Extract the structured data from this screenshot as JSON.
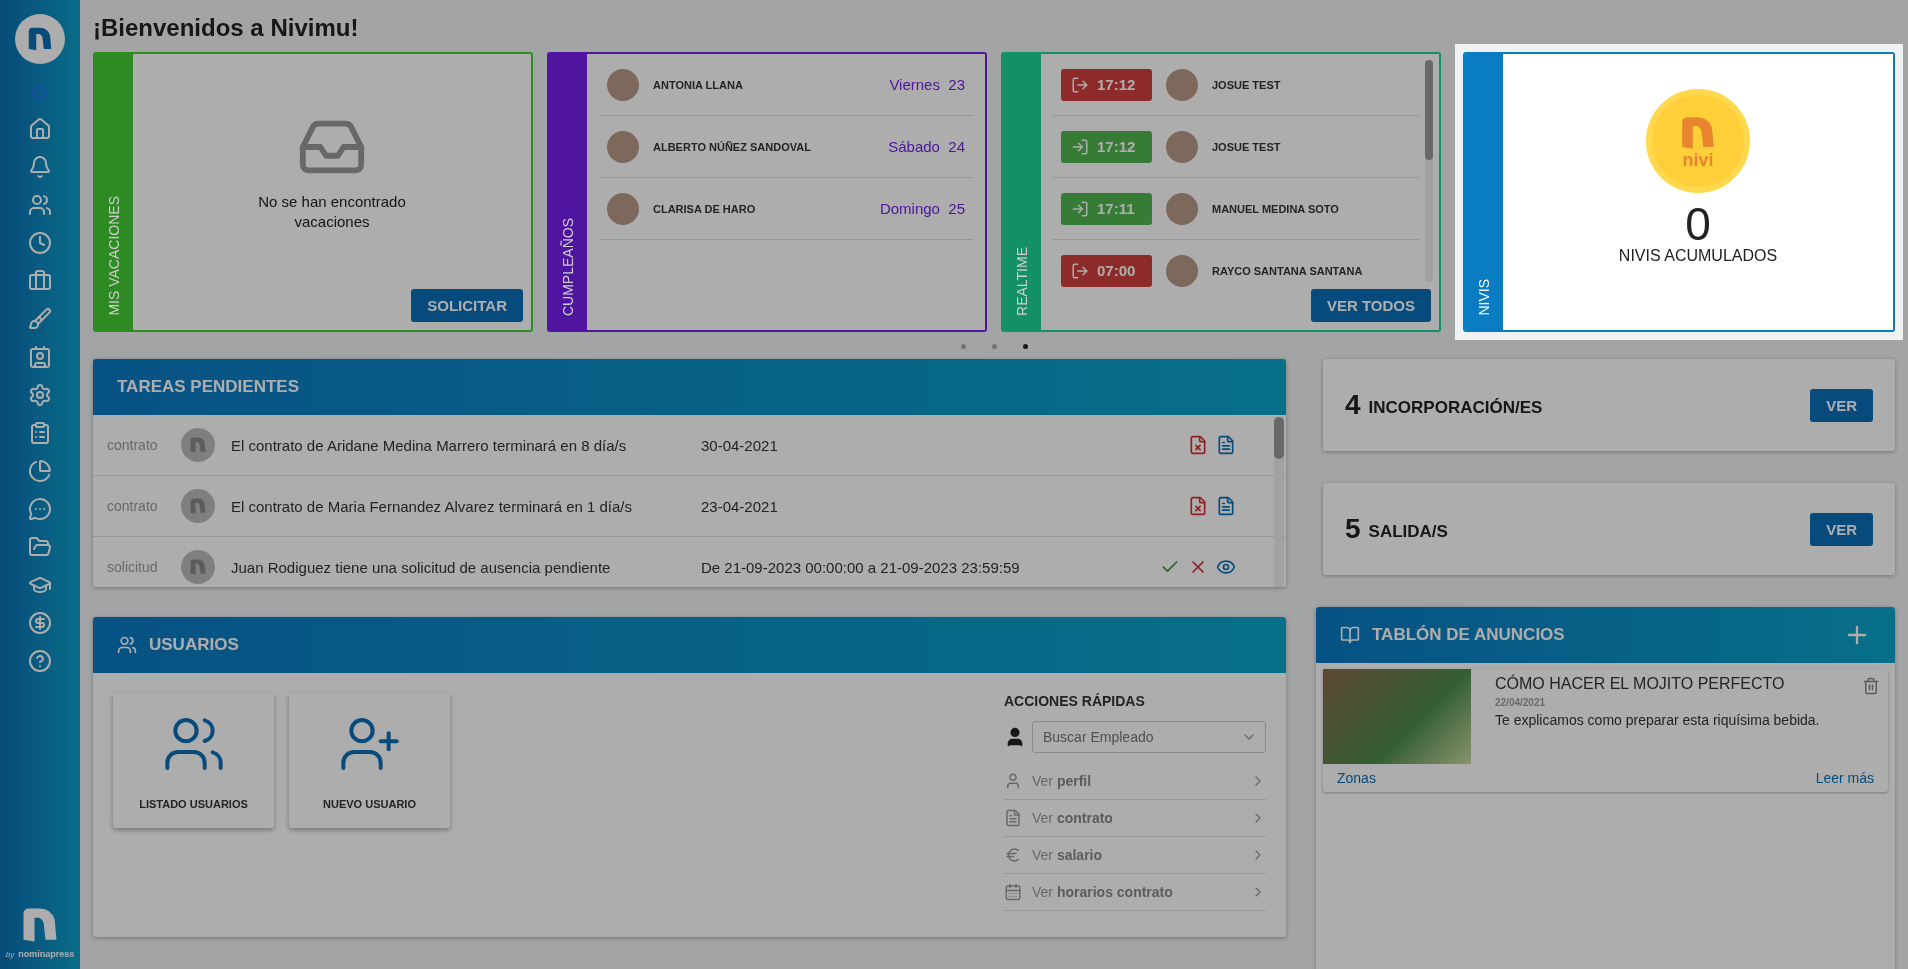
{
  "sidebar": {
    "brand_by": "by",
    "brand_name": "nominapress"
  },
  "title": "¡Bienvenidos a Nivimu!",
  "top_cards": [
    {
      "kind": "vacations",
      "title": "MIS VACACIONES",
      "color": "#2e8a22",
      "highlighted": false,
      "empty_text": "No se han encontrado vacaciones",
      "button": "SOLICITAR"
    },
    {
      "kind": "birthdays",
      "title": "CUMPLEAÑOS",
      "color": "#4f14a0",
      "highlighted": false,
      "people": [
        {
          "name": "ANTONIA LLANA",
          "day": "Viernes",
          "date": "23"
        },
        {
          "name": "ALBERTO NÚÑEZ SANDOVAL",
          "day": "Sábado",
          "date": "24"
        },
        {
          "name": "CLARISA DE HARO",
          "day": "Domingo",
          "date": "25"
        }
      ]
    },
    {
      "kind": "realtime",
      "title": "REALTIME",
      "color": "#139068",
      "highlighted": false,
      "button": "VER TODOS",
      "entries": [
        {
          "kind": "exit",
          "time": "17:12",
          "name": "JOSUE TEST"
        },
        {
          "kind": "entry",
          "time": "17:12",
          "name": "JOSUE TEST"
        },
        {
          "kind": "entry",
          "time": "17:11",
          "name": "MANUEL MEDINA SOTO"
        },
        {
          "kind": "exit",
          "time": "07:00",
          "name": "RAYCO SANTANA SANTANA"
        }
      ]
    },
    {
      "kind": "nivis",
      "title": "NIVIS",
      "color": "#0a7cc1",
      "highlighted": true,
      "coin_label": "nivi",
      "count": "0",
      "caption": "NIVIS ACUMULADOS"
    }
  ],
  "carousel_dots": [
    {
      "selected": false
    },
    {
      "selected": false
    },
    {
      "selected": true
    }
  ],
  "tasks": {
    "title": "TAREAS PENDIENTES",
    "rows": [
      {
        "kind": "contract",
        "type": "contrato",
        "text": "El contrato de Aridane Medina Marrero terminará en 8 día/s",
        "date": "30-04-2021"
      },
      {
        "kind": "contract",
        "type": "contrato",
        "text": "El contrato de Maria Fernandez Alvarez terminará en 1 día/s",
        "date": "23-04-2021"
      },
      {
        "kind": "request",
        "type": "solicitud",
        "text": "Juan Rodiguez tiene una solicitud de ausencia pendiente",
        "date": "De 21-09-2023 00:00:00 a 21-09-2023 23:59:59"
      }
    ]
  },
  "counters": [
    {
      "number": "4",
      "label": "INCORPORACIÓN/ES",
      "button": "VER"
    },
    {
      "number": "5",
      "label": "SALIDA/S",
      "button": "VER"
    }
  ],
  "users": {
    "title": "USUARIOS",
    "tiles": [
      {
        "kind": "list",
        "label": "LISTADO USUARIOS"
      },
      {
        "kind": "new",
        "label": "NUEVO USUARIO"
      }
    ],
    "quick_title": "ACCIONES RÁPIDAS",
    "search": {
      "placeholder": "Buscar Empleado"
    },
    "actions": [
      {
        "kind": "profile",
        "label": "Ver **perfil**"
      },
      {
        "kind": "contract",
        "label": "Ver **contrato**"
      },
      {
        "kind": "salary",
        "label": "Ver **salario**"
      },
      {
        "kind": "schedule",
        "label": "Ver **horarios contrato**"
      }
    ]
  },
  "board": {
    "title": "TABLÓN DE ANUNCIOS",
    "post": {
      "title": "CÓMO HACER EL MOJITO PERFECTO",
      "date": "22/04/2021",
      "text": "Te explicamos como preparar esta riquísima bebida.",
      "tag": "Zonas",
      "link": "Leer más"
    }
  }
}
